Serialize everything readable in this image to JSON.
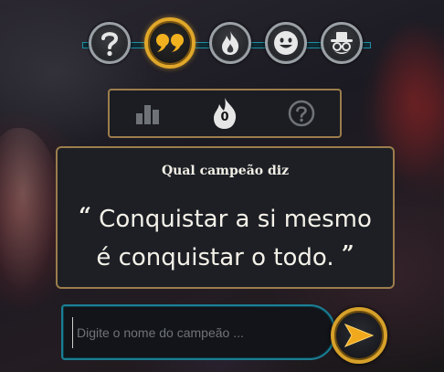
{
  "modes": [
    {
      "name": "classic",
      "icon": "question-icon",
      "active": false
    },
    {
      "name": "quote",
      "icon": "quote-icon",
      "active": true
    },
    {
      "name": "ability",
      "icon": "flame-icon",
      "active": false
    },
    {
      "name": "emoji",
      "icon": "smiley-icon",
      "active": false
    },
    {
      "name": "splash",
      "icon": "disguise-icon",
      "active": false
    }
  ],
  "hints": {
    "stats_icon": "bar-chart-icon",
    "flame_count": "0",
    "help_icon": "question-circle-icon"
  },
  "quote": {
    "title": "Qual campeão diz",
    "open_mark": "“",
    "line1": "Conquistar a si mesmo",
    "line2": "é conquistar o todo.",
    "close_mark": "”"
  },
  "answer": {
    "placeholder": "Digite o nome do campeão ...",
    "value": ""
  },
  "colors": {
    "accent_gold": "#e0a72a",
    "accent_teal": "#1f8ea4",
    "panel_bg": "#1d1f25",
    "panel_border": "#9c7d4c"
  }
}
